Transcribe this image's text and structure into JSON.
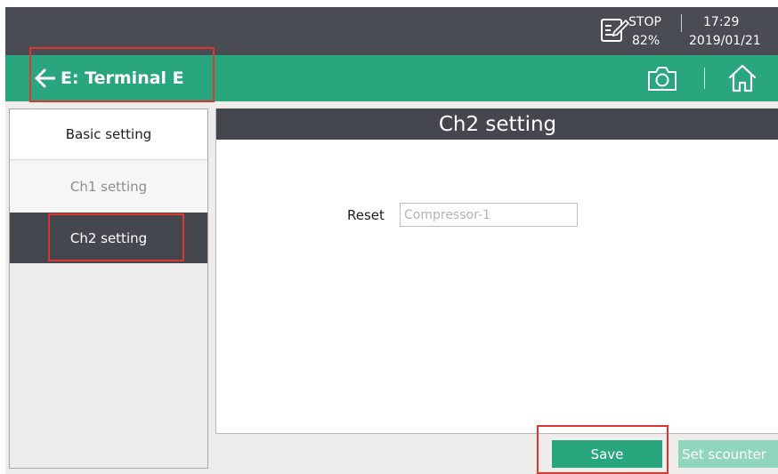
{
  "statusbar": {
    "state": "STOP",
    "battery": "82%",
    "time": "17:29",
    "date": "2019/01/21"
  },
  "titlebar": {
    "title": "E: Terminal E"
  },
  "sidebar": {
    "items": [
      {
        "label": "Basic setting"
      },
      {
        "label": "Ch1 setting"
      },
      {
        "label": "Ch2 setting"
      }
    ]
  },
  "panel": {
    "header": "Ch2 setting",
    "reset_label": "Reset",
    "reset_placeholder": "Compressor-1"
  },
  "buttons": {
    "save": "Save",
    "set_scounter": "Set scounter"
  },
  "colors": {
    "accent_green": "#2aa67f",
    "dark_bar": "#4a4c53",
    "annotation_red": "#e0342f"
  },
  "icons": [
    "record-icon",
    "back-arrow-icon",
    "camera-icon",
    "home-icon"
  ]
}
